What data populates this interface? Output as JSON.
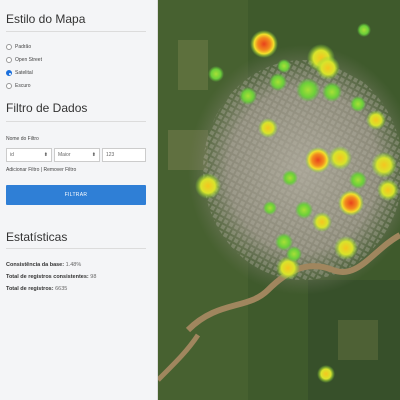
{
  "sidebar": {
    "map_style": {
      "title": "Estilo do Mapa",
      "options": [
        "Padrão",
        "Open Street",
        "Satelital",
        "Escuro"
      ],
      "selected": "Satelital"
    },
    "filter": {
      "title": "Filtro de Dados",
      "field_label": "Nome do Filtro",
      "field_select": "id",
      "operator_select": "Maior",
      "value_input": "123",
      "add_link": "Adicionar Filtro",
      "separator": "|",
      "remove_link": "Remover Filtro",
      "submit_label": "FILTRAR"
    },
    "stats": {
      "title": "Estatísticas",
      "items": [
        {
          "label": "Consistência da base:",
          "value": "1.48%"
        },
        {
          "label": "Total de registros consistentes:",
          "value": "98"
        },
        {
          "label": "Total de registros:",
          "value": "6635"
        }
      ]
    }
  },
  "map": {
    "type": "satellite heatmap"
  },
  "colors": {
    "accent": "#2f7fd6",
    "heat_low": "#7cd63a",
    "heat_mid": "#f2e12c",
    "heat_high": "#e8421c"
  }
}
